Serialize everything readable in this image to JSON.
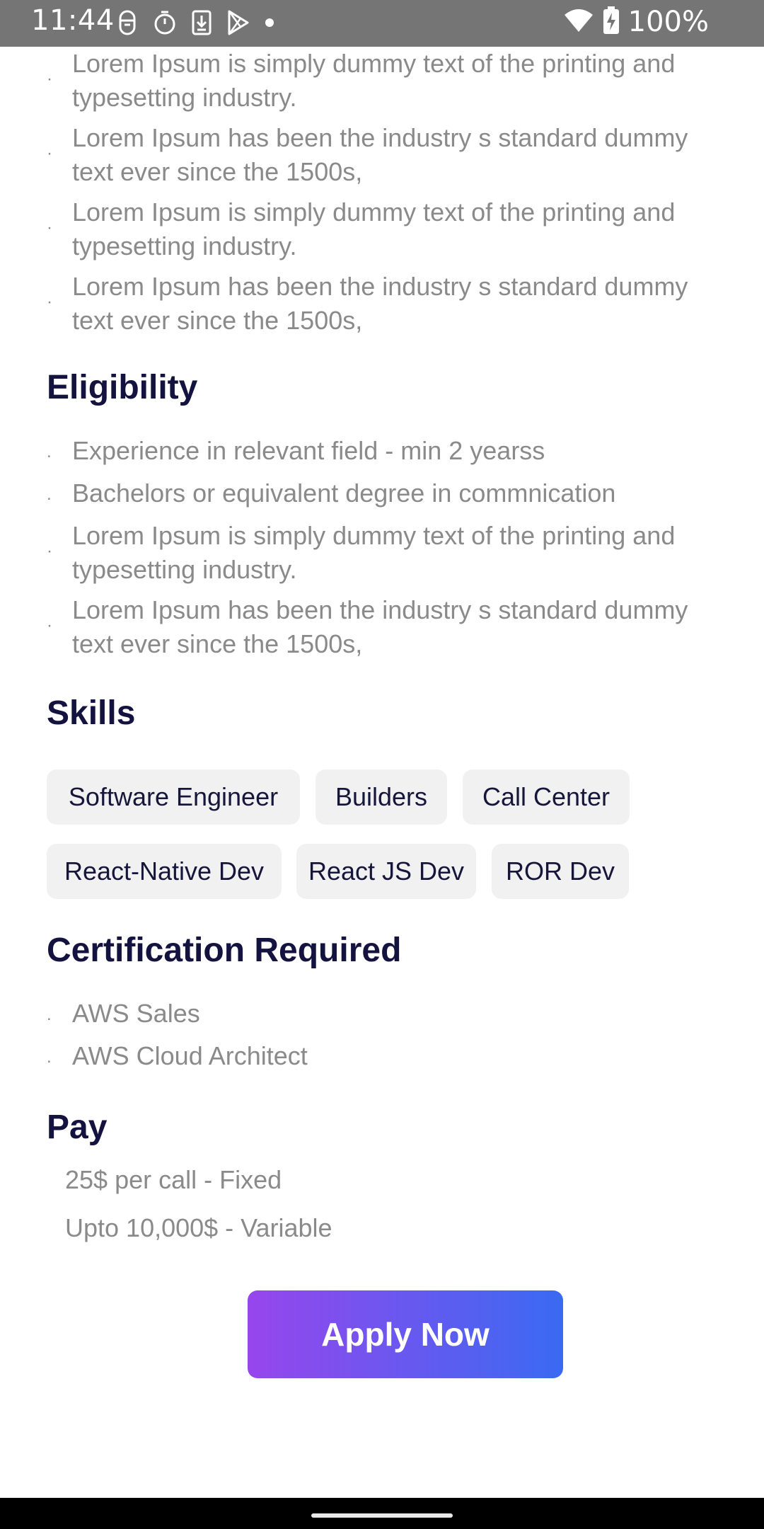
{
  "status_bar": {
    "time": "11:44",
    "battery": "100%"
  },
  "intro_list": [
    "Lorem Ipsum is simply dummy text of the printing and typesetting industry.",
    "Lorem Ipsum has been the industry s standard dummy text ever since the 1500s,",
    "Lorem Ipsum is simply dummy text of the printing and typesetting industry.",
    "Lorem Ipsum has been the industry s standard dummy text ever since the 1500s,"
  ],
  "eligibility": {
    "title": "Eligibility",
    "items": [
      "Experience in relevant field - min 2 yearss",
      "Bachelors or equivalent degree in commnication",
      "Lorem Ipsum is simply dummy text of the printing and typesetting industry.",
      "Lorem Ipsum has been the industry s standard dummy text ever since the 1500s,"
    ]
  },
  "skills": {
    "title": "Skills",
    "chips": [
      "Software Engineer",
      "Builders",
      "Call Center",
      "React-Native Dev",
      "React JS Dev",
      "ROR Dev"
    ]
  },
  "certification": {
    "title": "Certification Required",
    "items": [
      "AWS Sales",
      "AWS Cloud Architect"
    ]
  },
  "pay": {
    "title": "Pay",
    "lines": [
      "25$ per call - Fixed",
      "Upto 10,000$ - Variable"
    ]
  },
  "apply_button": {
    "label": "Apply Now"
  },
  "colors": {
    "heading": "#14123e",
    "body_text": "#8a8a8a",
    "chip_bg": "#f1f1f1",
    "button_gradient_start": "#9746ec",
    "button_gradient_end": "#3a6af2",
    "status_bar": "#757575"
  }
}
